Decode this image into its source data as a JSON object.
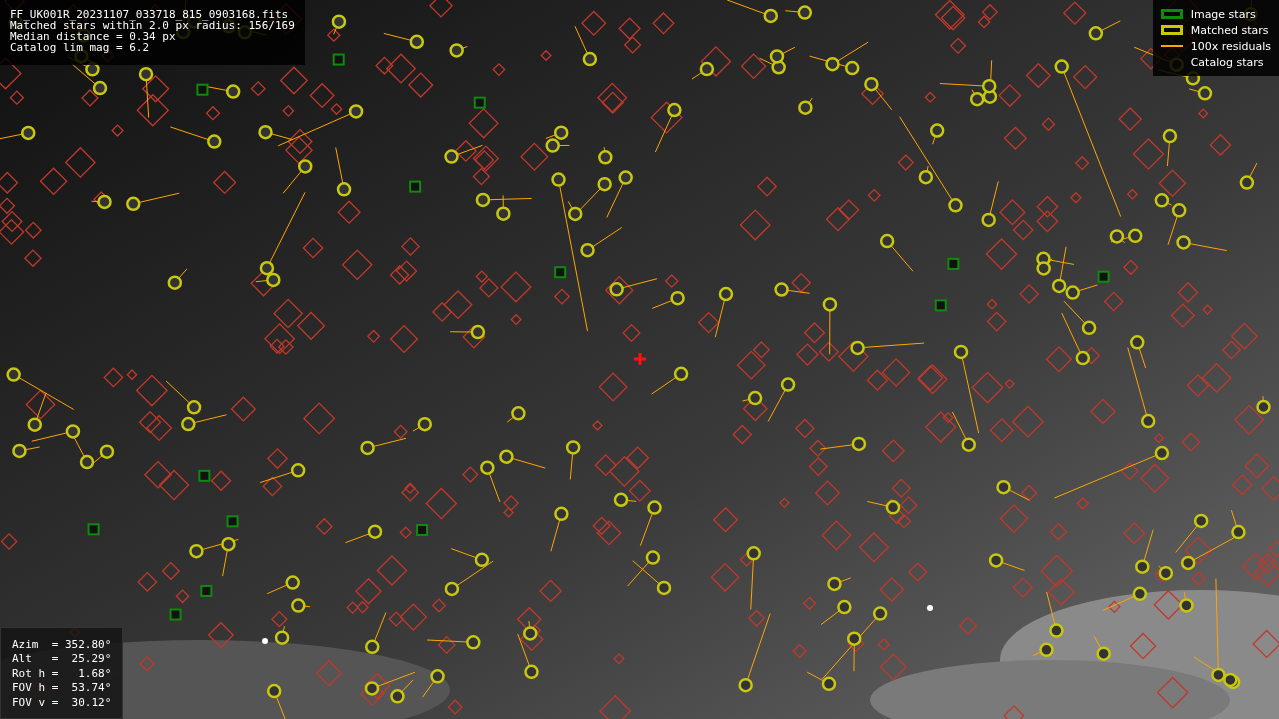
{
  "image_info": {
    "lines": [
      "FF_UK001R_20231107_033718_815_0903168.fits",
      "Matched stars within 2.0 px radius: 156/169",
      "Median distance = 0.34 px",
      "Catalog lim mag = 6.2"
    ]
  },
  "legend": [
    {
      "label": "Image stars",
      "kind": "box",
      "color": "#0f8a0f"
    },
    {
      "label": "Matched stars",
      "kind": "box",
      "color": "#c8c810"
    },
    {
      "label": "100x residuals",
      "kind": "line",
      "color": "#ffa500"
    },
    {
      "label": "Catalog stars",
      "kind": "none"
    }
  ],
  "pointing": [
    "Azim  = 352.80°",
    "Alt   =  25.29°",
    "Rot h =   1.68°",
    "FOV h =  53.74°",
    "FOV v =  30.12°"
  ]
}
